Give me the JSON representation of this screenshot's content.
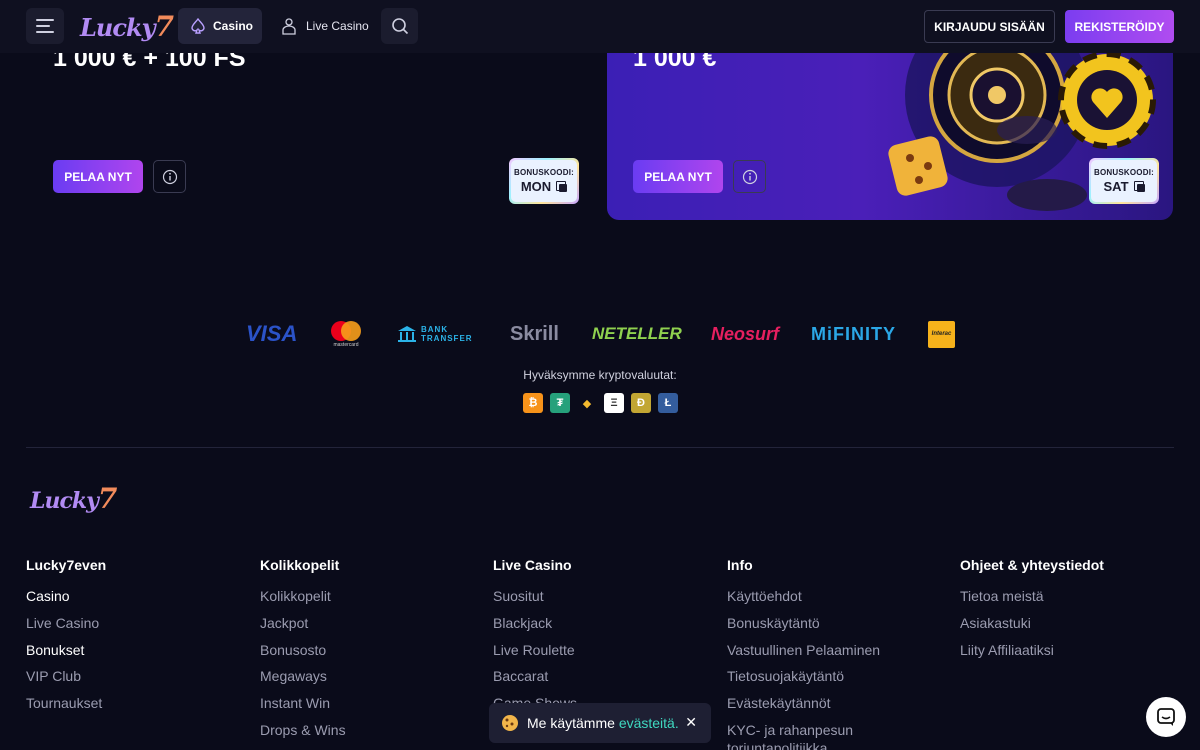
{
  "header": {
    "logo_text": "Lucky",
    "logo_seven": "7",
    "nav_casino": "Casino",
    "nav_live_casino": "Live Casino",
    "login": "KIRJAUDU SISÄÄN",
    "register": "REKISTERÖIDY"
  },
  "promos": [
    {
      "amount": "1 000 € + 100 FS",
      "play": "PELAA NYT",
      "bonus_label": "BONUSKOODI:",
      "bonus_code": "MON"
    },
    {
      "amount": "1 000 €",
      "play": "PELAA NYT",
      "bonus_label": "BONUSKOODI:",
      "bonus_code": "SAT"
    }
  ],
  "payments": {
    "visa": "VISA",
    "mastercard": "mastercard",
    "bank_1": "BANK",
    "bank_2": "TRANSFER",
    "skrill": "Skrill",
    "neteller": "NETELLER",
    "neosurf": "Neosurf",
    "mifinity": "MiFINITY",
    "interac": "Interac"
  },
  "crypto": {
    "title": "Hyväksymme kryptovaluutat:",
    "coins": [
      "₿",
      "₮",
      "◆",
      "Ξ",
      "Ð",
      "Ł"
    ],
    "colors": [
      "#f7931a",
      "#26a17b",
      "#f3ba2f",
      "#ffffff",
      "#c2a633",
      "#345d9d"
    ]
  },
  "footer": {
    "logo_text": "Lucky",
    "logo_seven": "7",
    "columns": [
      {
        "title": "Lucky7even",
        "links": [
          "Casino",
          "Live Casino",
          "Bonukset",
          "VIP Club",
          "Tournaukset"
        ]
      },
      {
        "title": "Kolikkopelit",
        "links": [
          "Kolikkopelit",
          "Jackpot",
          "Bonusosto",
          "Megaways",
          "Instant Win",
          "Drops & Wins"
        ]
      },
      {
        "title": "Live Casino",
        "links": [
          "Suositut",
          "Blackjack",
          "Live Roulette",
          "Baccarat",
          "Game Shows"
        ]
      },
      {
        "title": "Info",
        "links": [
          "Käyttöehdot",
          "Bonuskäytäntö",
          "Vastuullinen Pelaaminen",
          "Tietosuojakäytäntö",
          "Evästekäytännöt",
          "KYC- ja rahanpesun",
          "torjuntapolitiikka"
        ]
      },
      {
        "title": "Ohjeet & yhteystiedot",
        "links": [
          "Tietoa meistä",
          "Asiakastuki",
          "Liity Affiliaatiksi"
        ]
      }
    ]
  },
  "cookie": {
    "text": "Me käytämme",
    "link": "evästeitä.",
    "close": "✕"
  }
}
